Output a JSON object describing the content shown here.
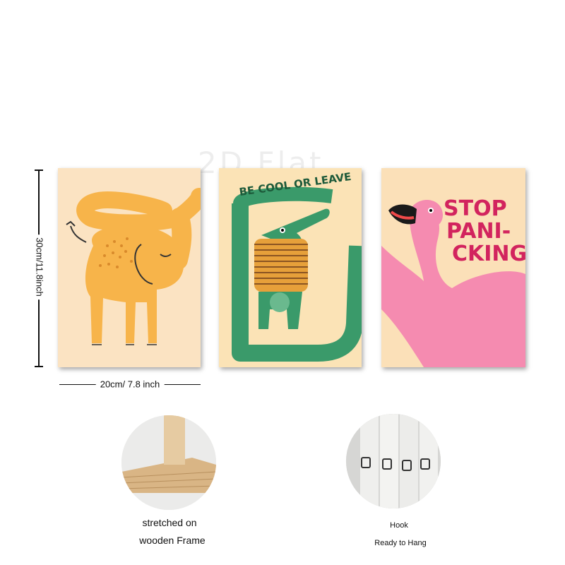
{
  "watermark": "2D Flat",
  "dimensions": {
    "height_label": "30cm/11.8inch",
    "width_label": "20cm/ 7.8 inch"
  },
  "prints": [
    {
      "name": "elephant",
      "colors": {
        "background": "#fbe3c2",
        "animal": "#f7b44a",
        "spots": "#d98a2b"
      }
    },
    {
      "name": "crocodile",
      "text": "BE COOL OR LEAVE",
      "colors": {
        "background": "#fbe3b6",
        "animal": "#3a9a6a",
        "stripes": "#e6a03a"
      }
    },
    {
      "name": "flamingo",
      "text_line_1": "STOP",
      "text_line_2": "PANI-",
      "text_line_3": "CKING",
      "colors": {
        "background": "#fbe0b8",
        "bird": "#f58bb0",
        "text": "#d2245e"
      }
    }
  ],
  "details": {
    "frame_caption_line_1": "stretched on",
    "frame_caption_line_2": "wooden Frame",
    "hook_caption_line_1": "Hook",
    "hook_caption_line_2": "Ready to Hang"
  }
}
